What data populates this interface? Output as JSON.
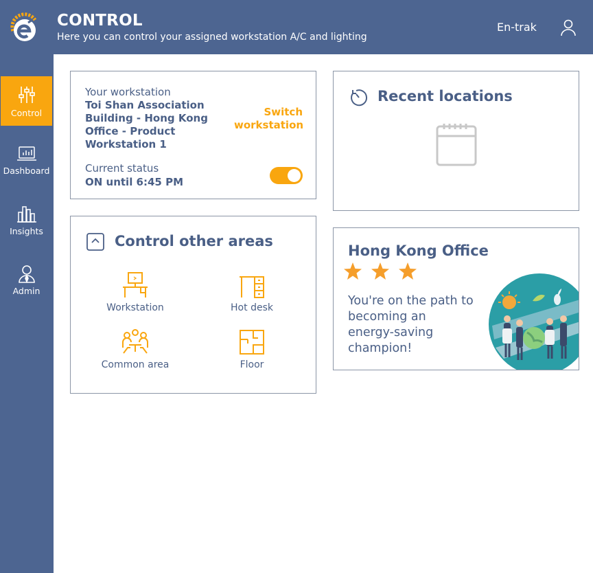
{
  "header": {
    "title": "CONTROL",
    "subtitle": "Here you can control your assigned workstation A/C and lighting",
    "brand": "En-trak"
  },
  "sidebar": {
    "items": [
      {
        "label": "Control",
        "icon": "sliders-icon",
        "active": true
      },
      {
        "label": "Dashboard",
        "icon": "dashboard-icon",
        "active": false
      },
      {
        "label": "Insights",
        "icon": "insights-icon",
        "active": false
      },
      {
        "label": "Admin",
        "icon": "admin-icon",
        "active": false
      }
    ]
  },
  "workstation": {
    "label": "Your workstation",
    "name": "Toi Shan Association Building - Hong Kong Office - Product Workstation 1",
    "switch_label": "Switch workstation",
    "status_label": "Current status",
    "status_value": "ON until 6:45 PM",
    "toggle_on": true
  },
  "recent": {
    "title": "Recent locations",
    "icon": "history-icon",
    "empty_icon": "calendar-icon"
  },
  "areas": {
    "title": "Control other areas",
    "icon": "expand-icon",
    "items": [
      {
        "label": "Workstation",
        "icon": "workstation-icon"
      },
      {
        "label": "Hot desk",
        "icon": "hot-desk-icon"
      },
      {
        "label": "Common area",
        "icon": "common-area-icon"
      },
      {
        "label": "Floor",
        "icon": "floor-icon"
      }
    ]
  },
  "office": {
    "title": "Hong Kong Office",
    "stars": 3,
    "message": "You're on the path to becoming an energy-saving champion!"
  },
  "colors": {
    "primary": "#4d6591",
    "accent": "#f9a60f",
    "text": "#4a5f86",
    "border": "#8b95a6"
  }
}
